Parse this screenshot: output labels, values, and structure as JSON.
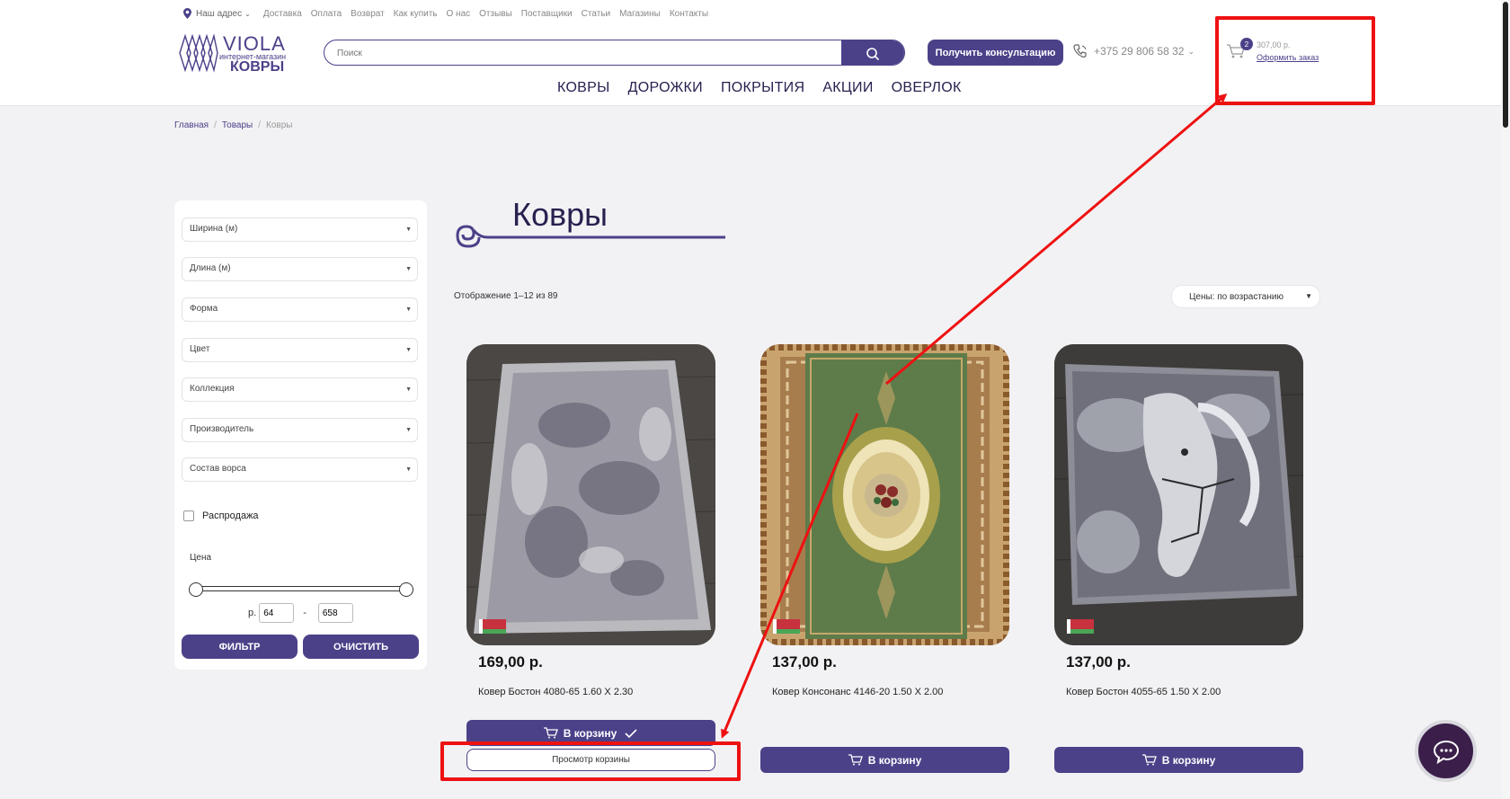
{
  "topnav": {
    "address": "Наш адрес",
    "links": [
      "Доставка",
      "Оплата",
      "Возврат",
      "Как купить",
      "О нас",
      "Отзывы",
      "Поставщики",
      "Статьи",
      "Магазины",
      "Контакты"
    ]
  },
  "logo": {
    "brand": "VIOLA",
    "subtitle": "интернет-магазин",
    "category": "КОВРЫ"
  },
  "search": {
    "placeholder": "Поиск"
  },
  "consult_label": "Получить консультацию",
  "phone": "+375 29 806 58 32",
  "cart": {
    "count": "2",
    "total": "307,00 р.",
    "order_link": "Оформить заказ"
  },
  "mainnav": [
    "КОВРЫ",
    "ДОРОЖКИ",
    "ПОКРЫТИЯ",
    "АКЦИИ",
    "ОВЕРЛОК"
  ],
  "breadcrumb": [
    "Главная",
    "Товары",
    "Ковры"
  ],
  "filters": {
    "selects": [
      "Ширина (м)",
      "Длина (м)",
      "Форма",
      "Цвет",
      "Коллекция",
      "Производитель",
      "Состав ворса"
    ],
    "sale_label": "Распродажа",
    "price_label": "Цена",
    "currency": "р.",
    "min": "64",
    "max": "658",
    "filter_btn": "ФИЛЬТР",
    "clear_btn": "ОЧИСТИТЬ"
  },
  "page_title": "Ковры",
  "showing": "Отображение 1–12 из 89",
  "sort": "Цены: по возрастанию",
  "products": [
    {
      "price": "169,00 р.",
      "name": "Ковер Бостон 4080-65 1.60 X 2.30",
      "button": "В корзину",
      "view_cart": "Просмотр корзины"
    },
    {
      "price": "137,00 р.",
      "name": "Ковер Консонанс 4146-20 1.50 X 2.00",
      "button": "В корзину"
    },
    {
      "price": "137,00 р.",
      "name": "Ковер Бостон 4055-65 1.50 X 2.00",
      "button": "В корзину"
    }
  ],
  "colors": {
    "accent": "#4b4189",
    "annotation": "#ee1111"
  }
}
